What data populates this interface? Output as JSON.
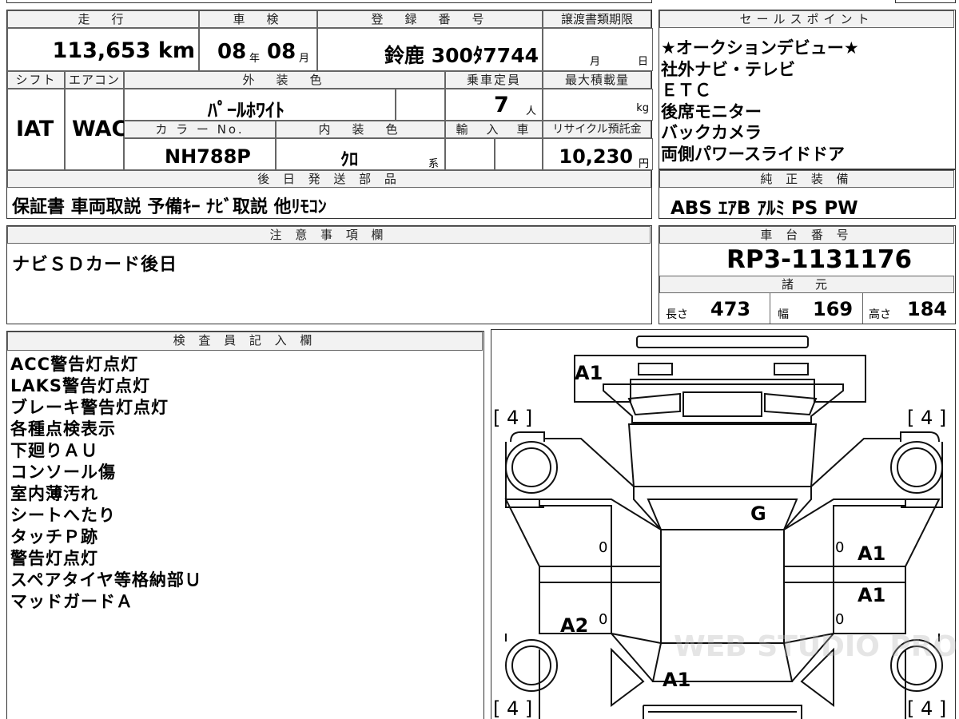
{
  "top": {
    "mileage_h": "走　行",
    "mileage": "113,653 km",
    "inspection_h": "車　検",
    "insp_year": "08",
    "insp_year_u": "年",
    "insp_month": "08",
    "insp_month_u": "月",
    "reg_h": "登　録　番　号",
    "reg": "鈴鹿 300ﾀ7744",
    "transfer_h": "譲渡書類期限",
    "transfer_month_u": "月",
    "transfer_day_u": "日"
  },
  "row2": {
    "shift_h": "シフト",
    "ac_h": "エアコン",
    "ext_color_h": "外　装　色",
    "capacity_h": "乗車定員",
    "maxload_h": "最大積載量",
    "shift": "IAT",
    "ac": "WAC",
    "ext_color": "ﾊﾟｰﾙﾎﾜｲﾄ",
    "capacity": "7",
    "capacity_u": "人",
    "maxload_u": "kg",
    "color_no_h": "カ ラ ー No.",
    "interior_h": "内　装　色",
    "import_h": "輸　入　車",
    "recycle_h": "リサイクル預託金",
    "color_no": "NH788P",
    "interior": "ｸﾛ",
    "interior_u": "系",
    "recycle": "10,230",
    "recycle_u": "円"
  },
  "later_parts": {
    "header": "後 日 発 送 部 品",
    "text": "保証書 車両取説 予備ｷｰ ﾅﾋﾞ取説 他ﾘﾓｺﾝ"
  },
  "sales_points": {
    "header": "セールスポイント",
    "items": [
      "★オークションデビュー★",
      "社外ナビ・テレビ",
      "ＥＴＣ",
      "後席モニター",
      "バックカメラ",
      "両側パワースライドドア"
    ]
  },
  "equipment": {
    "header": "純 正 装 備",
    "text": "ABS ｴｱB ｱﾙﾐ PS PW"
  },
  "notes": {
    "header": "注 意 事 項 欄",
    "text": "ナビＳＤカード後日"
  },
  "chassis": {
    "header": "車 台 番 号",
    "value": "RP3-1131176"
  },
  "specs": {
    "header": "諸　元",
    "length_l": "長さ",
    "length": "473",
    "width_l": "幅",
    "width": "169",
    "height_l": "高さ",
    "height": "184"
  },
  "inspector": {
    "header": "検 査 員 記 入 欄",
    "lines": [
      "ACC警告灯点灯",
      "LAKS警告灯点灯",
      "ブレーキ警告灯点灯",
      "各種点検表示",
      "下廻りＡＵ",
      "コンソール傷",
      "室内薄汚れ",
      "シートへたり",
      "タッチＰ跡",
      "警告灯点灯",
      "スペアタイヤ等格納部Ｕ",
      "マッドガードＡ"
    ]
  },
  "diagram": {
    "front_bumper": "A1",
    "windshield": "G",
    "right_front_door": "A1",
    "right_rear_door": "A1",
    "left_rear_door": "A2",
    "rear": "A1",
    "tire_fl": "[ 4 ]",
    "tire_fr": "[ 4 ]",
    "tire_rl": "[ 4 ]",
    "tire_rr": "[ 4 ]",
    "zero": "0",
    "watermark": "WEB STUDIO PRO"
  }
}
